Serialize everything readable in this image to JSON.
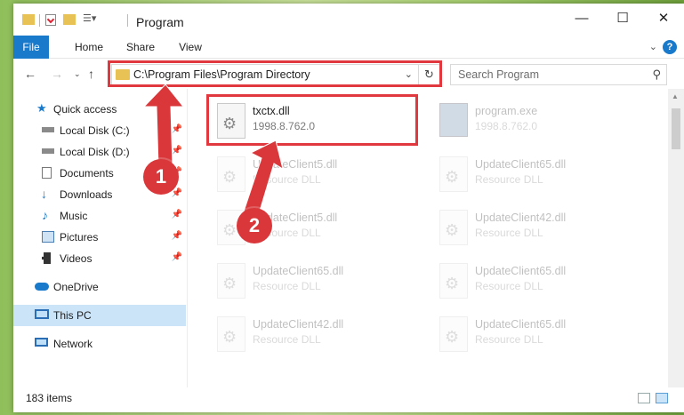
{
  "title": "Program",
  "ribbon": {
    "file": "File",
    "home": "Home",
    "share": "Share",
    "view": "View",
    "help": "?"
  },
  "window_controls": {
    "minimize": "—",
    "maximize": "☐",
    "close": "✕"
  },
  "address": {
    "path": "C:\\Program Files\\Program Directory",
    "refresh": "↻",
    "dropdown": "⌄"
  },
  "search": {
    "placeholder": "Search Program"
  },
  "nav": {
    "items": [
      {
        "label": "Quick access"
      },
      {
        "label": "Local Disk (C:)"
      },
      {
        "label": "Local Disk (D:)"
      },
      {
        "label": "Documents"
      },
      {
        "label": "Downloads"
      },
      {
        "label": "Music"
      },
      {
        "label": "Pictures"
      },
      {
        "label": "Videos"
      },
      {
        "label": "OneDrive"
      },
      {
        "label": "This PC"
      },
      {
        "label": "Network"
      }
    ]
  },
  "files": [
    {
      "name": "txctx.dll",
      "detail": "1998.8.762.0"
    },
    {
      "name": "program.exe",
      "detail": "1998.8.762.0"
    },
    {
      "name": "UpdateClient5.dll",
      "detail": "Resource DLL"
    },
    {
      "name": "UpdateClient65.dll",
      "detail": "Resource DLL"
    },
    {
      "name": "UpdateClient5.dll",
      "detail": "Resource DLL"
    },
    {
      "name": "UpdateClient42.dll",
      "detail": "Resource DLL"
    },
    {
      "name": "UpdateClient65.dll",
      "detail": "Resource DLL"
    },
    {
      "name": "UpdateClient65.dll",
      "detail": "Resource DLL"
    },
    {
      "name": "UpdateClient42.dll",
      "detail": "Resource DLL"
    },
    {
      "name": "UpdateClient65.dll",
      "detail": "Resource DLL"
    }
  ],
  "status": {
    "items": "183 items"
  },
  "annotations": {
    "step1": "1",
    "step2": "2",
    "color": "#e0383e"
  },
  "colors": {
    "accent": "#1979ca",
    "selected": "#cce4f7",
    "folder": "#e8c254"
  }
}
